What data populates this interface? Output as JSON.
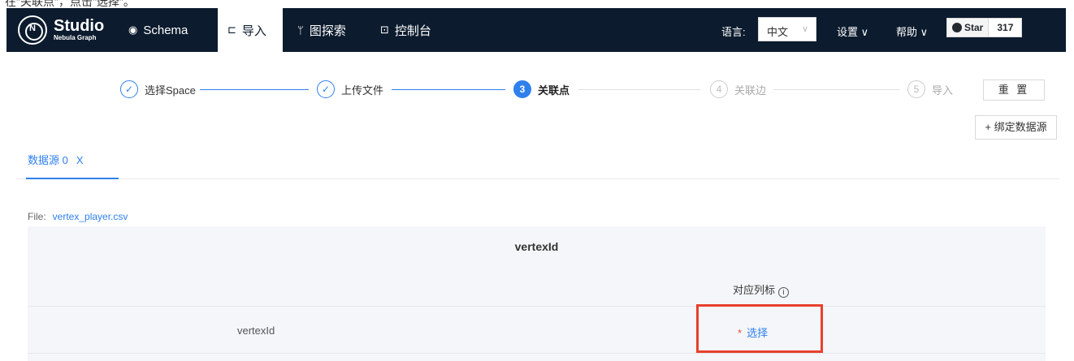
{
  "caption": "在\"关联点\"，点击\"选择\"。",
  "nav": {
    "logo_title": "Studio",
    "logo_subtitle": "Nebula Graph",
    "logo_mark": "N",
    "items": [
      {
        "label": "Schema",
        "icon": "schema-icon"
      },
      {
        "label": "导入",
        "icon": "import-icon"
      },
      {
        "label": "图探索",
        "icon": "explore-icon"
      },
      {
        "label": "控制台",
        "icon": "console-icon"
      }
    ],
    "language_label": "语言:",
    "language_value": "中文",
    "settings": "设置",
    "help": "帮助",
    "star_label": "Star",
    "star_count": "317"
  },
  "steps": [
    {
      "num": "1",
      "label": "选择Space",
      "state": "done"
    },
    {
      "num": "2",
      "label": "上传文件",
      "state": "done"
    },
    {
      "num": "3",
      "label": "关联点",
      "state": "current"
    },
    {
      "num": "4",
      "label": "关联边",
      "state": "wait"
    },
    {
      "num": "5",
      "label": "导入",
      "state": "wait"
    }
  ],
  "reset_label": "重 置",
  "bind_source_label": "+ 绑定数据源",
  "tab_label": "数据源 0",
  "tab_close": "X",
  "file_label": "File:",
  "file_name": "vertex_player.csv",
  "panel_title": "vertexId",
  "column_header": "对应列标",
  "row_name": "vertexId",
  "select_required": "*",
  "select_label": "选择",
  "colors": {
    "nav_bg": "#0c1b2e",
    "accent": "#2f80ed",
    "highlight": "#e8402c"
  }
}
